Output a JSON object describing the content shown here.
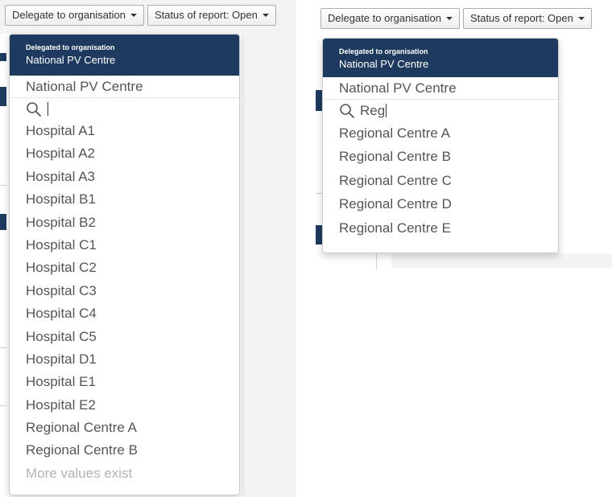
{
  "left": {
    "toolbar": {
      "delegate_label": "Delegate to organisation",
      "status_label": "Status of report: Open"
    },
    "dropdown": {
      "header_label": "Delegated to organisation",
      "header_value": "National PV Centre",
      "current_value": "National PV Centre",
      "search_value": "",
      "items": [
        "Hospital A1",
        "Hospital A2",
        "Hospital A3",
        "Hospital B1",
        "Hospital B2",
        "Hospital C1",
        "Hospital C2",
        "Hospital C3",
        "Hospital C4",
        "Hospital C5",
        "Hospital D1",
        "Hospital E1",
        "Hospital E2",
        "Regional Centre A",
        "Regional Centre B"
      ],
      "more_text": "More values exist"
    }
  },
  "right": {
    "toolbar": {
      "delegate_label": "Delegate to organisation",
      "status_label": "Status of report: Open"
    },
    "dropdown": {
      "header_label": "Delegated to organisation",
      "header_value": "National PV Centre",
      "current_value": "National PV Centre",
      "search_value": "Reg",
      "items": [
        "Regional Centre A",
        "Regional Centre B",
        "Regional Centre C",
        "Regional Centre D",
        "Regional Centre E"
      ]
    }
  },
  "icons": {
    "search": "search-icon",
    "caret": "caret-down-icon"
  },
  "colors": {
    "header_bg": "#1e3a5f",
    "text": "#555555",
    "muted": "#b3b3b3",
    "page_bg": "#f3f3f3"
  }
}
